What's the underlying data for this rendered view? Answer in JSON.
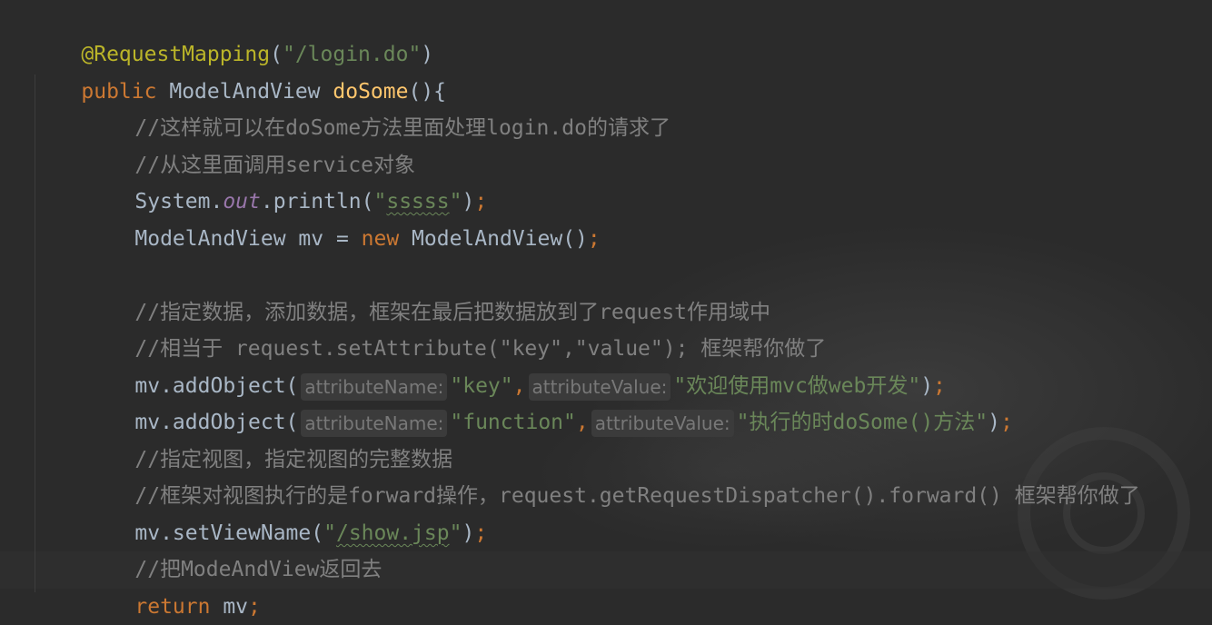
{
  "editor": {
    "theme_colors": {
      "background": "#2b2b2b",
      "keyword": "#cc7832",
      "annotation": "#bbb529",
      "string": "#6a8759",
      "comment": "#808080",
      "method": "#ffc66d",
      "static_field": "#9876aa",
      "text": "#a9b7c6"
    },
    "lines": {
      "l1": {
        "annotation": "@RequestMapping",
        "open_paren": "(",
        "string": "\"/login.do\"",
        "close_paren": ")"
      },
      "l2": {
        "kw_public": "public",
        "return_type": "ModelAndView",
        "method_name": "doSome",
        "params": "(){"
      },
      "l3": {
        "comment": "//这样就可以在doSome方法里面处理login.do的请求了"
      },
      "l4": {
        "comment": "//从这里面调用service对象"
      },
      "l5": {
        "prefix": "System.",
        "field": "out",
        "call": ".println(",
        "string_open": "\"",
        "string_body": "sssss",
        "string_close": "\"",
        "close": ")",
        "semi": ";"
      },
      "l6": {
        "type": "ModelAndView mv = ",
        "kw_new": "new",
        "ctor": " ModelAndView()",
        "semi": ";"
      },
      "l8": {
        "comment": "//指定数据，添加数据，框架在最后把数据放到了request作用域中"
      },
      "l9": {
        "comment": "//相当于 request.setAttribute(\"key\",\"value\"); 框架帮你做了"
      },
      "l10": {
        "call": "mv.addObject(",
        "hint1": "attributeName:",
        "arg1": "\"key\"",
        "comma": ",",
        "hint2": "attributeValue:",
        "arg2": "\"欢迎使用mvc做web开发\"",
        "close": ")",
        "semi": ";"
      },
      "l11": {
        "call": "mv.addObject(",
        "hint1": "attributeName:",
        "arg1": "\"function\"",
        "comma": ",",
        "hint2": "attributeValue:",
        "arg2": "\"执行的时doSome()方法\"",
        "close": ")",
        "semi": ";"
      },
      "l12": {
        "comment": "//指定视图，指定视图的完整数据"
      },
      "l13": {
        "comment": "//框架对视图执行的是forward操作，request.getRequestDispatcher().forward() 框架帮你做了"
      },
      "l14": {
        "call": "mv.setViewName(",
        "string_open": "\"",
        "string_body": "/show.jsp",
        "string_close": "\"",
        "close": ")",
        "semi": ";"
      },
      "l15": {
        "comment": "//把ModeAndView返回去"
      },
      "l16": {
        "kw_return": "return",
        "value": " mv",
        "semi": ";"
      },
      "l17": {
        "brace": "}"
      }
    }
  }
}
